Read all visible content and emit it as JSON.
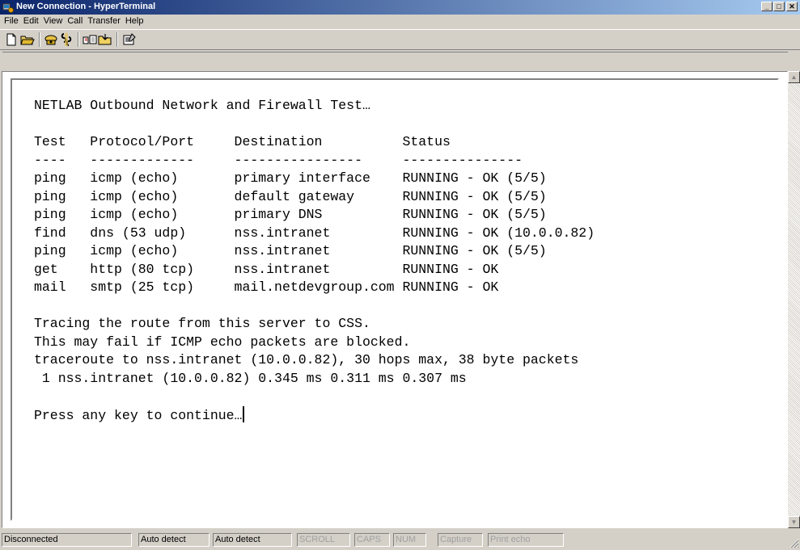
{
  "window": {
    "title": "New Connection - HyperTerminal",
    "minimize_glyph": "_",
    "maximize_glyph": "□",
    "close_glyph": "✕"
  },
  "menu": [
    "File",
    "Edit",
    "View",
    "Call",
    "Transfer",
    "Help"
  ],
  "toolbar": {
    "buttons": [
      "new-icon",
      "open-icon",
      "dial-icon",
      "disconnect-icon",
      "send-icon",
      "receive-icon",
      "properties-icon"
    ]
  },
  "terminal": {
    "lines": [
      "NETLAB Outbound Network and Firewall Test…",
      "",
      "Test   Protocol/Port     Destination          Status",
      "----   -------------     ----------------     ---------------",
      "ping   icmp (echo)       primary interface    RUNNING - OK (5/5)",
      "ping   icmp (echo)       default gateway      RUNNING - OK (5/5)",
      "ping   icmp (echo)       primary DNS          RUNNING - OK (5/5)",
      "find   dns (53 udp)      nss.intranet         RUNNING - OK (10.0.0.82)",
      "ping   icmp (echo)       nss.intranet         RUNNING - OK (5/5)",
      "get    http (80 tcp)     nss.intranet         RUNNING - OK",
      "mail   smtp (25 tcp)     mail.netdevgroup.com RUNNING - OK",
      "",
      "Tracing the route from this server to CSS.",
      "This may fail if ICMP echo packets are blocked.",
      "traceroute to nss.intranet (10.0.0.82), 30 hops max, 38 byte packets",
      " 1 nss.intranet (10.0.0.82) 0.345 ms 0.311 ms 0.307 ms",
      "",
      "Press any key to continue…"
    ]
  },
  "statusbar": {
    "connection": "Disconnected",
    "emulation": "Auto detect",
    "settings": "Auto detect",
    "scroll": "SCROLL",
    "caps": "CAPS",
    "num": "NUM",
    "capture": "Capture",
    "print_echo": "Print echo"
  },
  "colors": {
    "title_active": "#0a246a",
    "face": "#d4d0c8",
    "terminal_bg": "#ffffff"
  }
}
